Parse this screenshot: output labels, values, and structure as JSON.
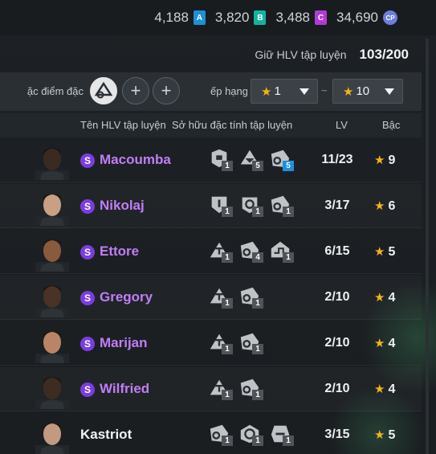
{
  "currencies": [
    {
      "value": "4,188",
      "badge": "A",
      "icon": "a-coin-icon"
    },
    {
      "value": "3,820",
      "badge": "B",
      "icon": "b-coin-icon"
    },
    {
      "value": "3,488",
      "badge": "C",
      "icon": "c-coin-icon"
    },
    {
      "value": "34,690",
      "badge": "CP",
      "icon": "cp-coin-icon"
    }
  ],
  "keep": {
    "label": "Giữ HLV tập luyện",
    "count": "103/200"
  },
  "filter": {
    "trait_label": "ặc điểm đặc",
    "grade_label": "ếp hạng",
    "add_symbol": "+",
    "grade_min": "1",
    "grade_max": "10",
    "range_symbol": "~"
  },
  "columns": {
    "name": "Tên HLV tập luyện",
    "traits": "Sở hữu đặc tính tập luyện",
    "lv": "LV",
    "grade": "Bậc"
  },
  "coaches": [
    {
      "name": "Macoumba",
      "special": "S",
      "lv": "11/23",
      "grade": "9",
      "traits": [
        {
          "icon": "trait-a-icon",
          "lvl": "1"
        },
        {
          "icon": "trait-b-icon",
          "lvl": "5"
        },
        {
          "icon": "trait-c-icon",
          "lvl": "5"
        }
      ]
    },
    {
      "name": "Nikolaj",
      "special": "S",
      "lv": "3/17",
      "grade": "6",
      "traits": [
        {
          "icon": "trait-d-icon",
          "lvl": "1"
        },
        {
          "icon": "trait-e-icon",
          "lvl": "1"
        },
        {
          "icon": "trait-c-icon",
          "lvl": "1"
        }
      ]
    },
    {
      "name": "Ettore",
      "special": "S",
      "lv": "6/15",
      "grade": "5",
      "traits": [
        {
          "icon": "trait-f-icon",
          "lvl": "1"
        },
        {
          "icon": "trait-c-icon",
          "lvl": "4"
        },
        {
          "icon": "trait-g-icon",
          "lvl": "1"
        }
      ]
    },
    {
      "name": "Gregory",
      "special": "S",
      "lv": "2/10",
      "grade": "4",
      "traits": [
        {
          "icon": "trait-f-icon",
          "lvl": "1"
        },
        {
          "icon": "trait-c-icon",
          "lvl": "1"
        }
      ]
    },
    {
      "name": "Marijan",
      "special": "S",
      "lv": "2/10",
      "grade": "4",
      "traits": [
        {
          "icon": "trait-f-icon",
          "lvl": "1"
        },
        {
          "icon": "trait-c-icon",
          "lvl": "1"
        }
      ]
    },
    {
      "name": "Wilfried",
      "special": "S",
      "lv": "2/10",
      "grade": "4",
      "traits": [
        {
          "icon": "trait-f-icon",
          "lvl": "1"
        },
        {
          "icon": "trait-c-icon",
          "lvl": "1"
        }
      ]
    },
    {
      "name": "Kastriot",
      "special": "",
      "lv": "3/15",
      "grade": "5",
      "traits": [
        {
          "icon": "trait-c-icon",
          "lvl": "1"
        },
        {
          "icon": "trait-h-icon",
          "lvl": "1"
        },
        {
          "icon": "trait-i-icon",
          "lvl": "1"
        }
      ]
    }
  ],
  "colors": {
    "special_name": "#c07ef5",
    "star": "#f2b418",
    "special_badge": "#7b3ce0",
    "trait_lvl_high": "#1e8fe0"
  }
}
